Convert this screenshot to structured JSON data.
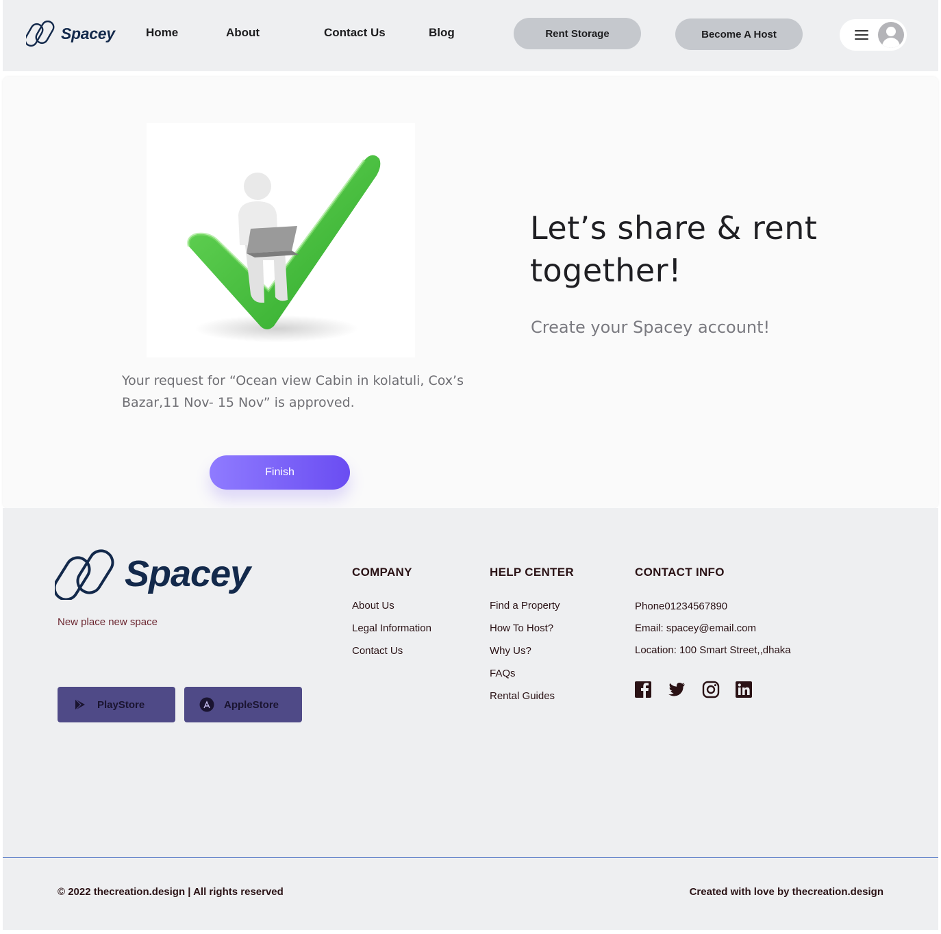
{
  "brand": {
    "name": "Spacey",
    "tagline": "New place new  space",
    "color": "#13294b"
  },
  "nav": {
    "links": [
      "Home",
      "About",
      "Contact Us",
      "Blog"
    ],
    "rent_storage": "Rent Storage",
    "become_host": "Become A Host",
    "menu_icon": "hamburger-icon",
    "avatar_icon": "user-avatar-icon"
  },
  "main": {
    "approval_message": "Your request for “Ocean view Cabin in kolatuli, Cox’s Bazar,11 Nov- 15 Nov”  is approved.",
    "finish_label": "Finish",
    "headline": "Let’s share & rent together!",
    "subheadline": "Create your Spacey account!",
    "accent_color": "#7b63f8",
    "illustration_icon": "person-on-checkmark-icon"
  },
  "footer": {
    "stores": [
      {
        "label": "PlayStore",
        "icon": "play-store-icon"
      },
      {
        "label": "AppleStore",
        "icon": "app-store-icon"
      }
    ],
    "company": {
      "title": "COMPANY",
      "links": [
        "About Us",
        "Legal Information",
        "Contact Us"
      ]
    },
    "help": {
      "title": "HELP CENTER",
      "links": [
        "Find a Property",
        "How To Host?",
        "Why Us?",
        "FAQs",
        "Rental Guides"
      ]
    },
    "contact": {
      "title": "CONTACT INFO",
      "lines": [
        "Phone01234567890",
        "Email: spacey@email.com",
        "Location: 100 Smart Street,,dhaka"
      ]
    },
    "social_icons": [
      "facebook-icon",
      "twitter-icon",
      "instagram-icon",
      "linkedin-icon"
    ],
    "copyright": "© 2022 thecreation.design | All rights reserved",
    "created_prefix": "Created with love by ",
    "created_brand": "thecreation.design"
  }
}
